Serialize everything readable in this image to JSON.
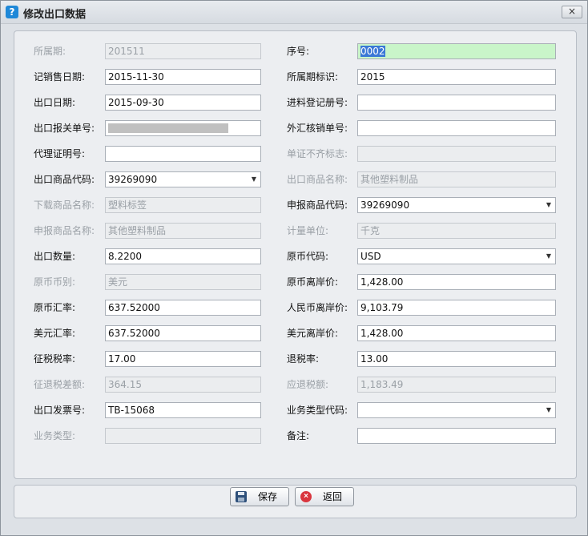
{
  "window": {
    "title": "修改出口数据",
    "close_label": "×"
  },
  "left": [
    {
      "label": "所属期:",
      "value": "201511",
      "disabled": true
    },
    {
      "label": "记销售日期:",
      "value": "2015-11-30",
      "disabled": false
    },
    {
      "label": "出口日期:",
      "value": "2015-09-30",
      "disabled": false
    },
    {
      "label": "出口报关单号:",
      "value": "",
      "disabled": false,
      "redacted": true
    },
    {
      "label": "代理证明号:",
      "value": "",
      "disabled": false
    },
    {
      "label": "出口商品代码:",
      "value": "39269090",
      "disabled": false,
      "dropdown": true
    },
    {
      "label": "下载商品名称:",
      "value": "塑料标签",
      "disabled": true
    },
    {
      "label": "申报商品名称:",
      "value": "其他塑料制品",
      "disabled": true
    },
    {
      "label": "出口数量:",
      "value": "8.2200",
      "disabled": false
    },
    {
      "label": "原币币别:",
      "value": "美元",
      "disabled": true
    },
    {
      "label": "原币汇率:",
      "value": "637.52000",
      "disabled": false
    },
    {
      "label": "美元汇率:",
      "value": "637.52000",
      "disabled": false
    },
    {
      "label": "征税税率:",
      "value": "17.00",
      "disabled": false
    },
    {
      "label": "征退税差额:",
      "value": "364.15",
      "disabled": true
    },
    {
      "label": "出口发票号:",
      "value": "TB-15068",
      "disabled": false
    },
    {
      "label": "业务类型:",
      "value": "",
      "disabled": true
    }
  ],
  "right": [
    {
      "label": "序号:",
      "value": "0002",
      "disabled": false,
      "highlight": true
    },
    {
      "label": "所属期标识:",
      "value": "2015",
      "disabled": false
    },
    {
      "label": "进料登记册号:",
      "value": "",
      "disabled": false
    },
    {
      "label": "外汇核销单号:",
      "value": "",
      "disabled": false
    },
    {
      "label": "单证不齐标志:",
      "value": "",
      "disabled": true
    },
    {
      "label": "出口商品名称:",
      "value": "其他塑料制品",
      "disabled": true
    },
    {
      "label": "申报商品代码:",
      "value": "39269090",
      "disabled": false,
      "dropdown": true
    },
    {
      "label": "计量单位:",
      "value": "千克",
      "disabled": true
    },
    {
      "label": "原币代码:",
      "value": "USD",
      "disabled": false,
      "dropdown": true
    },
    {
      "label": "原币离岸价:",
      "value": "1,428.00",
      "disabled": false
    },
    {
      "label": "人民币离岸价:",
      "value": "9,103.79",
      "disabled": false
    },
    {
      "label": "美元离岸价:",
      "value": "1,428.00",
      "disabled": false
    },
    {
      "label": "退税率:",
      "value": "13.00",
      "disabled": false
    },
    {
      "label": "应退税额:",
      "value": "1,183.49",
      "disabled": true
    },
    {
      "label": "业务类型代码:",
      "value": "",
      "disabled": false,
      "dropdown": true
    },
    {
      "label": "备注:",
      "value": "",
      "disabled": false
    }
  ],
  "buttons": {
    "save_label": "保存",
    "back_label": "返回"
  },
  "colors": {
    "highlight_bg": "#c9f5c9",
    "selection": "#3a78d6",
    "save_icon": "#2d4f7a",
    "back_icon": "#d9363e"
  },
  "icons": {
    "app": "app-logo-icon",
    "save": "floppy-disk-icon",
    "back": "cancel-circle-icon"
  }
}
